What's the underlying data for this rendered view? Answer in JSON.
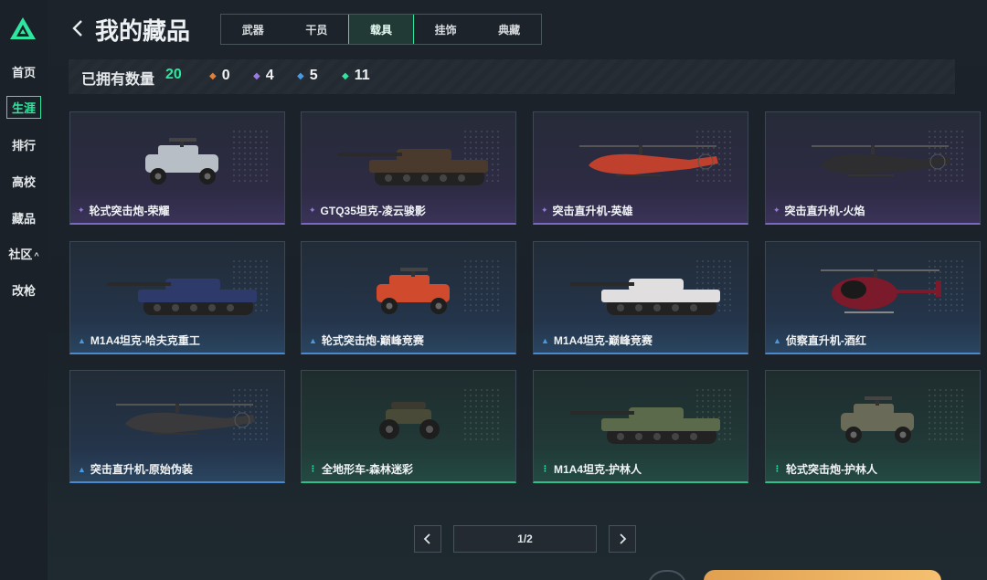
{
  "sidebar": {
    "items": [
      {
        "label": "首页",
        "active": false
      },
      {
        "label": "生涯",
        "active": true
      },
      {
        "label": "排行",
        "active": false
      },
      {
        "label": "高校",
        "active": false
      },
      {
        "label": "藏品",
        "active": false
      },
      {
        "label": "社区",
        "active": false,
        "caret": "^"
      },
      {
        "label": "改枪",
        "active": false
      }
    ]
  },
  "header": {
    "back_icon": "chevron-left-icon",
    "title": "我的藏品",
    "tabs": [
      {
        "label": "武器",
        "active": false
      },
      {
        "label": "干员",
        "active": false
      },
      {
        "label": "载具",
        "active": true
      },
      {
        "label": "挂饰",
        "active": false
      },
      {
        "label": "典藏",
        "active": false
      }
    ]
  },
  "stats": {
    "label": "已拥有数量",
    "total": "20",
    "counts": [
      {
        "rarity": "orange",
        "color": "#e0803a",
        "value": "0"
      },
      {
        "rarity": "purple",
        "color": "#9a7ae0",
        "value": "4"
      },
      {
        "rarity": "blue",
        "color": "#4a9ae0",
        "value": "5"
      },
      {
        "rarity": "green",
        "color": "#2fe6a0",
        "value": "11"
      }
    ]
  },
  "items": [
    {
      "name": "轮式突击炮-荣耀",
      "rarity": "purple",
      "vehicle": "armored-car-icon",
      "livery": "#b8bec6"
    },
    {
      "name": "GTQ35坦克-凌云骏影",
      "rarity": "purple",
      "vehicle": "tank-icon",
      "livery": "#4a3a2e"
    },
    {
      "name": "突击直升机-英雄",
      "rarity": "purple",
      "vehicle": "helicopter-icon",
      "livery": "#c0402e"
    },
    {
      "name": "突击直升机-火焰",
      "rarity": "purple",
      "vehicle": "helicopter-icon",
      "livery": "#2e2e30"
    },
    {
      "name": "M1A4坦克-哈夫克重工",
      "rarity": "blue",
      "vehicle": "tank-icon",
      "livery": "#2e3a6a"
    },
    {
      "name": "轮式突击炮-巅峰竞赛",
      "rarity": "blue",
      "vehicle": "armored-car-icon",
      "livery": "#d04a2e"
    },
    {
      "name": "M1A4坦克-巅峰竞赛",
      "rarity": "blue",
      "vehicle": "tank-icon",
      "livery": "#e0dede"
    },
    {
      "name": "侦察直升机-酒红",
      "rarity": "blue",
      "vehicle": "scout-helicopter-icon",
      "livery": "#7a1a2a"
    },
    {
      "name": "突击直升机-原始伪装",
      "rarity": "blue",
      "vehicle": "helicopter-icon",
      "livery": "#3a3a3c"
    },
    {
      "name": "全地形车-森林迷彩",
      "rarity": "green",
      "vehicle": "atv-icon",
      "livery": "#4a4a38"
    },
    {
      "name": "M1A4坦克-护林人",
      "rarity": "green",
      "vehicle": "tank-icon",
      "livery": "#5a6a4a"
    },
    {
      "name": "轮式突击炮-护林人",
      "rarity": "green",
      "vehicle": "armored-car-icon",
      "livery": "#6a6a58"
    }
  ],
  "pagination": {
    "prev_icon": "chevron-left-icon",
    "next_icon": "chevron-right-icon",
    "page_text": "1/2"
  }
}
